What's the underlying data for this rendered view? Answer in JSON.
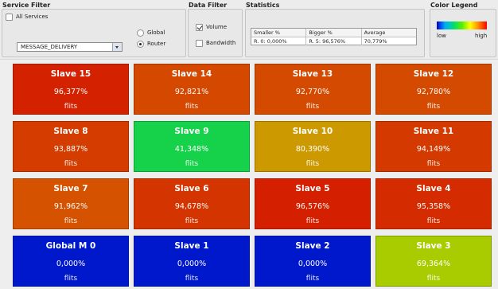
{
  "service_filter": {
    "title": "Service Filter",
    "all_services_label": "All Services",
    "all_services_checked": false,
    "service_value": "MESSAGE_DELIVERY",
    "scope_options": [
      {
        "label": "Global",
        "selected": false
      },
      {
        "label": "Router",
        "selected": true
      }
    ]
  },
  "data_filter": {
    "title": "Data Filter",
    "options": [
      {
        "label": "Volume",
        "checked": true
      },
      {
        "label": "Bandwidth",
        "checked": false
      }
    ]
  },
  "statistics": {
    "title": "Statistics",
    "columns": [
      "Smaller %",
      "Bigger %",
      "Average"
    ],
    "row": [
      "R. 0: 0,000%",
      "R. 5: 96,576%",
      "70,779%"
    ]
  },
  "color_legend": {
    "title": "Color Legend",
    "low_label": "low",
    "high_label": "high",
    "gradient_colors": [
      "#0000cc",
      "#00aaff",
      "#00dd77",
      "#55ee00",
      "#ffff00",
      "#ff8800",
      "#ff0000"
    ]
  },
  "nodes": [
    {
      "name": "Slave 15",
      "value": "96,377%",
      "unit": "flits",
      "color": "#d42200"
    },
    {
      "name": "Slave 14",
      "value": "92,821%",
      "unit": "flits",
      "color": "#d44800"
    },
    {
      "name": "Slave 13",
      "value": "92,770%",
      "unit": "flits",
      "color": "#d44a00"
    },
    {
      "name": "Slave 12",
      "value": "92,780%",
      "unit": "flits",
      "color": "#d44a00"
    },
    {
      "name": "Slave 8",
      "value": "93,887%",
      "unit": "flits",
      "color": "#d43c00"
    },
    {
      "name": "Slave 9",
      "value": "41,348%",
      "unit": "flits",
      "color": "#16d24a"
    },
    {
      "name": "Slave 10",
      "value": "80,390%",
      "unit": "flits",
      "color": "#cc9a00"
    },
    {
      "name": "Slave 11",
      "value": "94,149%",
      "unit": "flits",
      "color": "#d43a00"
    },
    {
      "name": "Slave 7",
      "value": "91,962%",
      "unit": "flits",
      "color": "#d45200"
    },
    {
      "name": "Slave 6",
      "value": "94,678%",
      "unit": "flits",
      "color": "#d43400"
    },
    {
      "name": "Slave 5",
      "value": "96,576%",
      "unit": "flits",
      "color": "#d41f00"
    },
    {
      "name": "Slave 4",
      "value": "95,358%",
      "unit": "flits",
      "color": "#d42c00"
    },
    {
      "name": "Global M 0",
      "value": "0,000%",
      "unit": "flits",
      "color": "#0018cc"
    },
    {
      "name": "Slave 1",
      "value": "0,000%",
      "unit": "flits",
      "color": "#0018cc"
    },
    {
      "name": "Slave 2",
      "value": "0,000%",
      "unit": "flits",
      "color": "#0018cc"
    },
    {
      "name": "Slave 3",
      "value": "69,364%",
      "unit": "flits",
      "color": "#a8cc00"
    }
  ]
}
